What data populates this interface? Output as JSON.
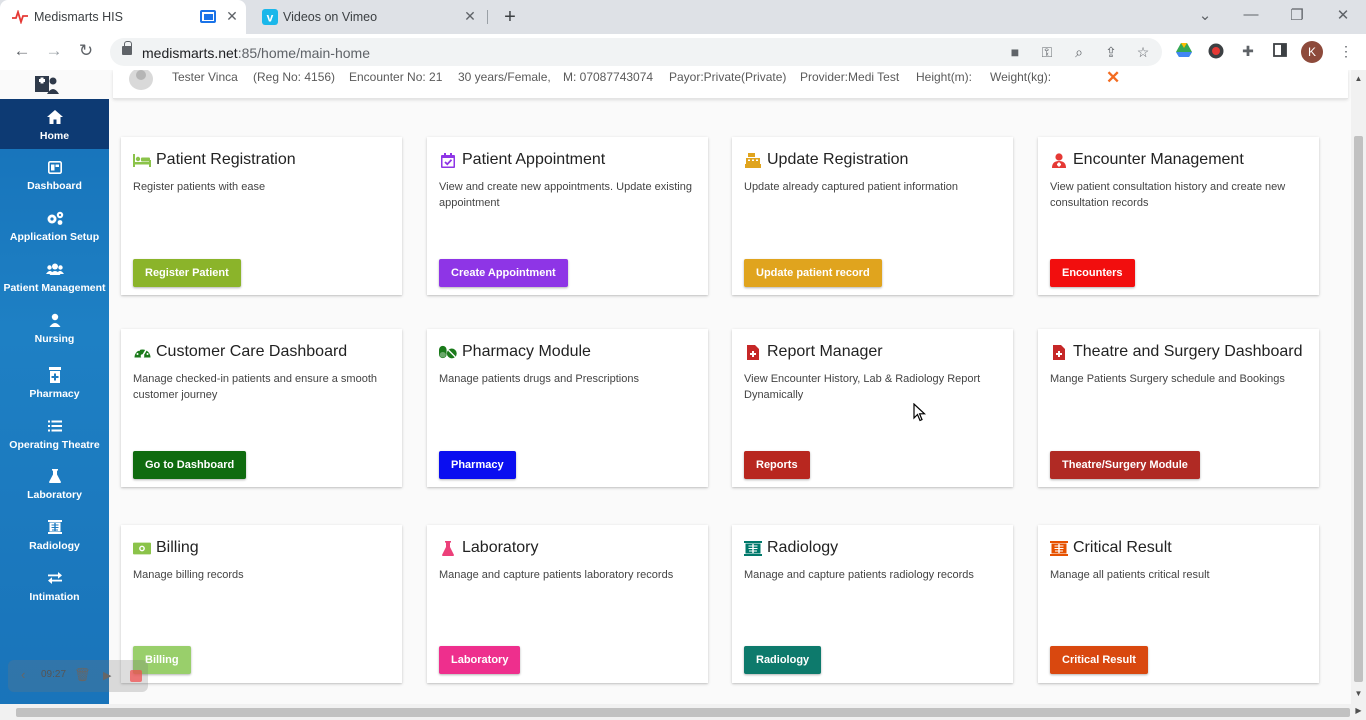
{
  "browser": {
    "tabs": [
      {
        "title": "Medismarts HIS",
        "active": true
      },
      {
        "title": "Videos on Vimeo",
        "active": false
      }
    ],
    "new_tab": "+",
    "url_host": "medismarts.net",
    "url_rest": ":85/home/main-home",
    "profile_initial": "K",
    "controls": {
      "minimize": "—",
      "restore": "❐",
      "close": "✕",
      "tab_close": "✕",
      "tab_list": "⌄"
    }
  },
  "sidebar": {
    "items": [
      {
        "label": "Home",
        "icon": "home-icon",
        "active": true
      },
      {
        "label": "Dashboard",
        "icon": "dashboard-icon"
      },
      {
        "label": "Application Setup",
        "icon": "cogs-icon"
      },
      {
        "label": "Patient Management",
        "icon": "users-icon"
      },
      {
        "label": "Nursing",
        "icon": "nurse-icon"
      },
      {
        "label": "Pharmacy",
        "icon": "pharmacy-icon"
      },
      {
        "label": "Operating Theatre",
        "icon": "list-icon"
      },
      {
        "label": "Laboratory",
        "icon": "flask-icon"
      },
      {
        "label": "Radiology",
        "icon": "xray-icon"
      },
      {
        "label": "Intimation",
        "icon": "exchange-icon"
      }
    ]
  },
  "patient": {
    "name": "Tester Vinca",
    "reg_no": "(Reg No: 4156)",
    "encounter": "Encounter No: 21",
    "age_sex": "30 years/Female,",
    "mobile": "M: 07087743074",
    "payor": "Payor:Private(Private)",
    "provider": "Provider:Medi Test",
    "height": "Height(m):",
    "weight": "Weight(kg):",
    "close": "✕"
  },
  "cards": [
    {
      "title": "Patient Registration",
      "desc": "Register patients with ease",
      "button": "Register Patient",
      "btn_color": "#8bb42a",
      "icon": "bed-icon",
      "icon_color": "#8bc34a"
    },
    {
      "title": "Patient Appointment",
      "desc": "View and create new appointments. Update existing appointment",
      "button": "Create Appointment",
      "btn_color": "#8e35e6",
      "icon": "calendar-check-icon",
      "icon_color": "#8e35e6"
    },
    {
      "title": "Update Registration",
      "desc": "Update already captured patient information",
      "button": "Update patient record",
      "btn_color": "#e0a41e",
      "icon": "cash-register-icon",
      "icon_color": "#e0a41e"
    },
    {
      "title": "Encounter Management",
      "desc": "View patient consultation history and create new consultation records",
      "button": "Encounters",
      "btn_color": "#f20e0e",
      "icon": "user-md-icon",
      "icon_color": "#e53935"
    },
    {
      "title": "Customer Care Dashboard",
      "desc": "Manage checked-in patients and ensure a smooth customer journey",
      "button": "Go to Dashboard",
      "btn_color": "#0f6b0f",
      "icon": "tachometer-icon",
      "icon_color": "#1b7a1b"
    },
    {
      "title": "Pharmacy Module",
      "desc": "Manage patients drugs and Prescriptions",
      "button": "Pharmacy",
      "btn_color": "#0a0ef0",
      "icon": "pills-icon",
      "icon_color": "#1b7a1b"
    },
    {
      "title": "Report Manager",
      "desc": "View Encounter History, Lab & Radiology Report Dynamically",
      "button": "Reports",
      "btn_color": "#b8271f",
      "icon": "file-medical-icon",
      "icon_color": "#c62828"
    },
    {
      "title": "Theatre and Surgery Dashboard",
      "desc": "Mange Patients Surgery schedule and Bookings",
      "button": "Theatre/Surgery Module",
      "btn_color": "#b02a24",
      "icon": "file-medical-icon",
      "icon_color": "#c62828"
    },
    {
      "title": "Billing",
      "desc": "Manage billing records",
      "button": "Billing",
      "btn_color": "#99cf6b",
      "icon": "money-bill-icon",
      "icon_color": "#8bc34a"
    },
    {
      "title": "Laboratory",
      "desc": "Manage and capture patients laboratory records",
      "button": "Laboratory",
      "btn_color": "#ee2f8d",
      "icon": "flask-icon",
      "icon_color": "#ec407a"
    },
    {
      "title": "Radiology",
      "desc": "Manage and capture patients radiology records",
      "button": "Radiology",
      "btn_color": "#0d7a6c",
      "icon": "xray-icon",
      "icon_color": "#00796b"
    },
    {
      "title": "Critical Result",
      "desc": "Manage all patients critical result",
      "button": "Critical Result",
      "btn_color": "#d9480f",
      "icon": "xray-icon",
      "icon_color": "#e65100"
    }
  ],
  "recorder": {
    "time": "09:27"
  }
}
